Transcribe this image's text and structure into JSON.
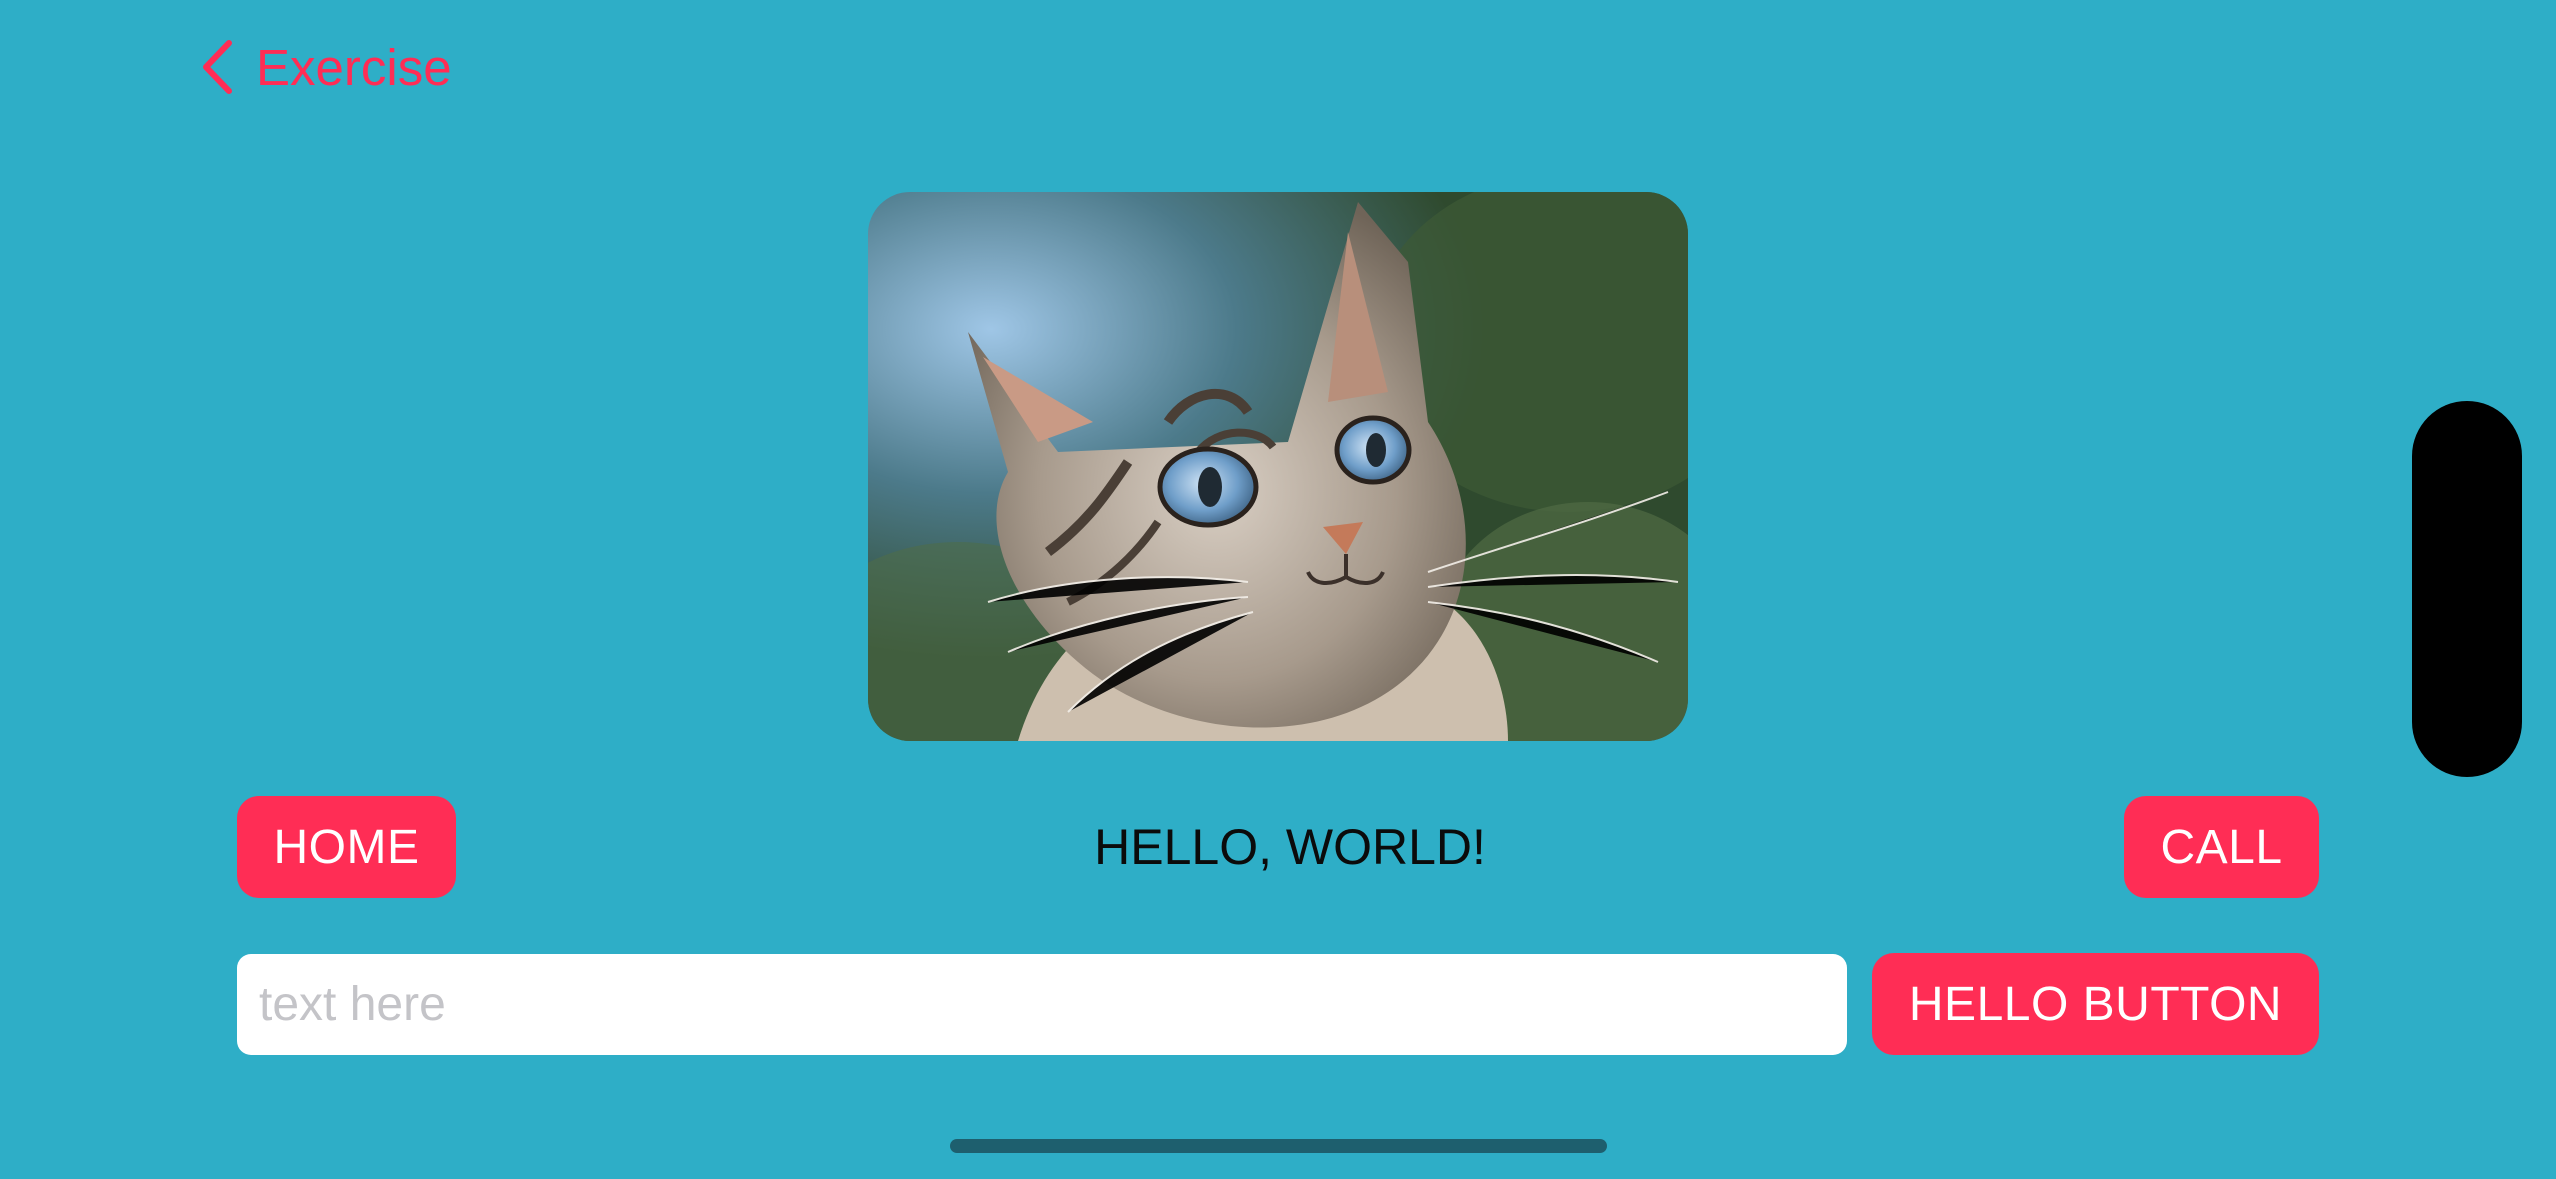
{
  "nav": {
    "back_label": "Exercise",
    "icon": "chevron-left-icon",
    "accent": "#ff2d55"
  },
  "image": {
    "alt": "cat-photo"
  },
  "buttons": {
    "home": "HOME",
    "call": "CALL",
    "hello": "HELLO BUTTON"
  },
  "greeting": "HELLO, WORLD!",
  "input": {
    "placeholder": "text here",
    "value": ""
  },
  "colors": {
    "background": "#2eaec7",
    "button": "#ff2d55",
    "text": "#0b0b0b"
  }
}
